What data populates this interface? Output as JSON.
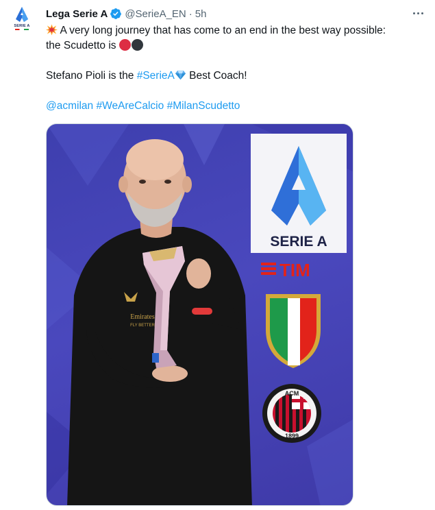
{
  "author": {
    "display_name": "Lega Serie A",
    "handle": "@SerieA_EN",
    "separator": "·",
    "time": "5h",
    "avatar_text": "SERIE A",
    "verified": true
  },
  "icons": {
    "verified": "verified-badge-icon",
    "more": "more-options-icon",
    "collision": "collision-emoji-icon",
    "gem": "gem-emoji-icon",
    "red_circle": "red-circle-emoji-icon",
    "black_circle": "black-circle-emoji-icon"
  },
  "tweet": {
    "line1": "A very long journey that has come to an end in the best way possible:",
    "line2": "the Scudetto is",
    "line3_pre": "Stefano Pioli is the",
    "line3_tag": "#SerieA",
    "line3_post": "Best Coach!",
    "tags": [
      "@acmilan",
      "#WeAreCalcio",
      "#MilanScudetto"
    ]
  },
  "media": {
    "board_brand": "SERIE A",
    "board_sponsor": "TIM",
    "club_badge_top": "ACM",
    "club_badge_year": "1899",
    "shirt_sponsor_line1": "Emirates",
    "shirt_sponsor_line2": "FLY BETTER"
  },
  "colors": {
    "link": "#1d9bf0",
    "text": "#0f1419",
    "secondary": "#536471",
    "backdrop": "#4243b4",
    "verified": "#1d9bf0"
  }
}
